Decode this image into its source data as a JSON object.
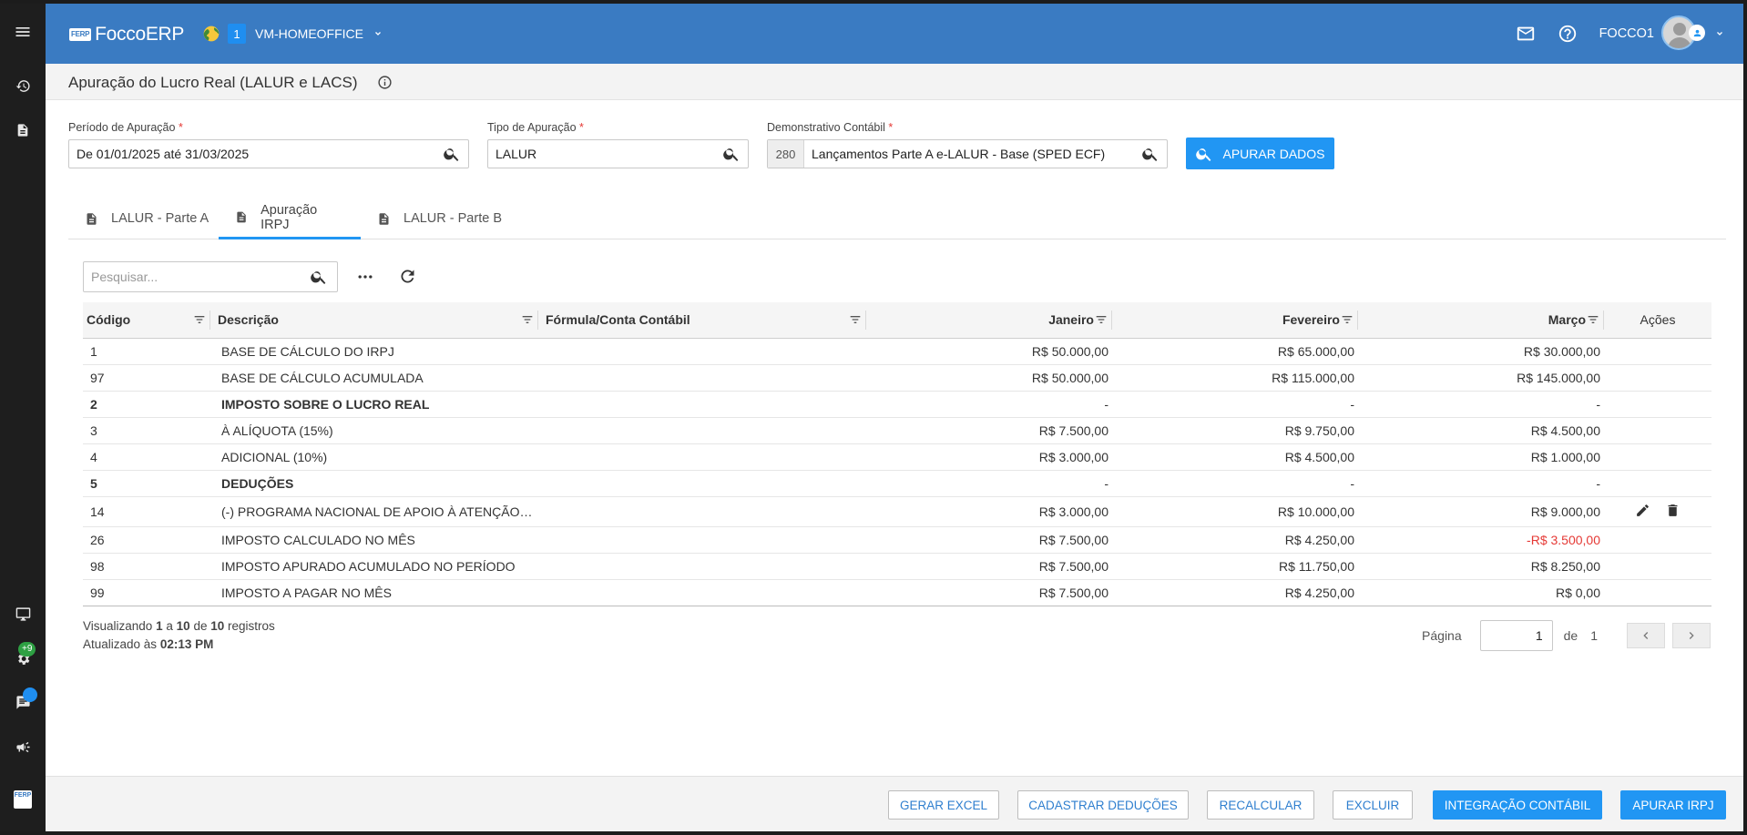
{
  "header": {
    "logo_text": "FoccoERP",
    "logo_mark": "FERP",
    "env_number": "1",
    "env_name": "VM-HOMEOFFICE",
    "user": "FOCCO1"
  },
  "sidebar": {
    "badge_plus": "+9"
  },
  "page": {
    "title": "Apuração do Lucro Real (LALUR e LACS)"
  },
  "form": {
    "periodo_label": "Período de Apuração",
    "periodo_value": "De 01/01/2025 até 31/03/2025",
    "tipo_label": "Tipo de Apuração",
    "tipo_value": "LALUR",
    "demonstrativo_label": "Demonstrativo Contábil",
    "demonstrativo_code": "280",
    "demonstrativo_value": "Lançamentos Parte A e-LALUR - Base (SPED ECF)",
    "required_mark": "*",
    "apurar_dados_label": "APURAR DADOS"
  },
  "tabs": [
    {
      "label": "LALUR - Parte A"
    },
    {
      "label": "Apuração IRPJ"
    },
    {
      "label": "LALUR - Parte B"
    }
  ],
  "search": {
    "placeholder": "Pesquisar..."
  },
  "table": {
    "columns": {
      "codigo": "Código",
      "descricao": "Descrição",
      "formula": "Fórmula/Conta Contábil",
      "janeiro": "Janeiro",
      "fevereiro": "Fevereiro",
      "marco": "Março",
      "acoes": "Ações"
    },
    "rows": [
      {
        "codigo": "1",
        "descricao": "BASE DE CÁLCULO DO IRPJ",
        "formula": "",
        "janeiro": "R$ 50.000,00",
        "fevereiro": "R$ 65.000,00",
        "marco": "R$ 30.000,00"
      },
      {
        "codigo": "97",
        "descricao": "BASE DE CÁLCULO ACUMULADA",
        "formula": "",
        "janeiro": "R$ 50.000,00",
        "fevereiro": "R$ 115.000,00",
        "marco": "R$ 145.000,00"
      },
      {
        "codigo": "2",
        "descricao": "IMPOSTO SOBRE O LUCRO REAL",
        "formula": "",
        "janeiro": "-",
        "fevereiro": "-",
        "marco": "-"
      },
      {
        "codigo": "3",
        "descricao": "À ALÍQUOTA (15%)",
        "formula": "",
        "janeiro": "R$ 7.500,00",
        "fevereiro": "R$ 9.750,00",
        "marco": "R$ 4.500,00"
      },
      {
        "codigo": "4",
        "descricao": "ADICIONAL (10%)",
        "formula": "",
        "janeiro": "R$ 3.000,00",
        "fevereiro": "R$ 4.500,00",
        "marco": "R$ 1.000,00"
      },
      {
        "codigo": "5",
        "descricao": "DEDUÇÕES",
        "formula": "",
        "janeiro": "-",
        "fevereiro": "-",
        "marco": "-"
      },
      {
        "codigo": "14",
        "descricao": "(-) PROGRAMA NACIONAL DE APOIO À ATENÇÃO ON...",
        "formula": "",
        "janeiro": "R$ 3.000,00",
        "fevereiro": "R$ 10.000,00",
        "marco": "R$ 9.000,00"
      },
      {
        "codigo": "26",
        "descricao": "IMPOSTO CALCULADO NO MÊS",
        "formula": "",
        "janeiro": "R$ 7.500,00",
        "fevereiro": "R$ 4.250,00",
        "marco": "-R$ 3.500,00"
      },
      {
        "codigo": "98",
        "descricao": "IMPOSTO APURADO ACUMULADO NO PERÍODO",
        "formula": "",
        "janeiro": "R$ 7.500,00",
        "fevereiro": "R$ 11.750,00",
        "marco": "R$ 8.250,00"
      },
      {
        "codigo": "99",
        "descricao": "IMPOSTO A PAGAR NO MÊS",
        "formula": "",
        "janeiro": "R$ 7.500,00",
        "fevereiro": "R$ 4.250,00",
        "marco": "R$ 0,00"
      }
    ]
  },
  "info": {
    "viewing_prefix": "Visualizando",
    "from": "1",
    "a": "a",
    "to": "10",
    "de": "de",
    "total": "10",
    "registros": "registros",
    "updated_prefix": "Atualizado às",
    "updated_time": "02:13 PM"
  },
  "pager": {
    "label": "Página",
    "current": "1",
    "of_label": "de",
    "total": "1"
  },
  "actions": {
    "gerar_excel": "GERAR EXCEL",
    "cadastrar_deducoes": "CADASTRAR DEDUÇÕES",
    "recalcular": "RECALCULAR",
    "excluir": "EXCLUIR",
    "integracao_contabil": "INTEGRAÇÃO CONTÁBIL",
    "apurar_irpj": "APURAR IRPJ"
  },
  "colors": {
    "header_bg": "#3a7bc2",
    "primary": "#2196f3",
    "sidebar_bg": "#1e1e1e",
    "negative": "#e53935",
    "badge_green": "#2ea043",
    "badge_blue": "#1f8ef0"
  },
  "icons": [
    "menu-icon",
    "history-icon",
    "document-icon",
    "monitor-icon",
    "gear-icon",
    "chat-icon",
    "megaphone-icon",
    "globe-icon",
    "mail-icon",
    "help-icon",
    "info-icon",
    "search-icon",
    "more-icon",
    "refresh-icon",
    "filter-icon",
    "edit-icon",
    "delete-icon",
    "chevron-left-icon",
    "chevron-right-icon"
  ]
}
